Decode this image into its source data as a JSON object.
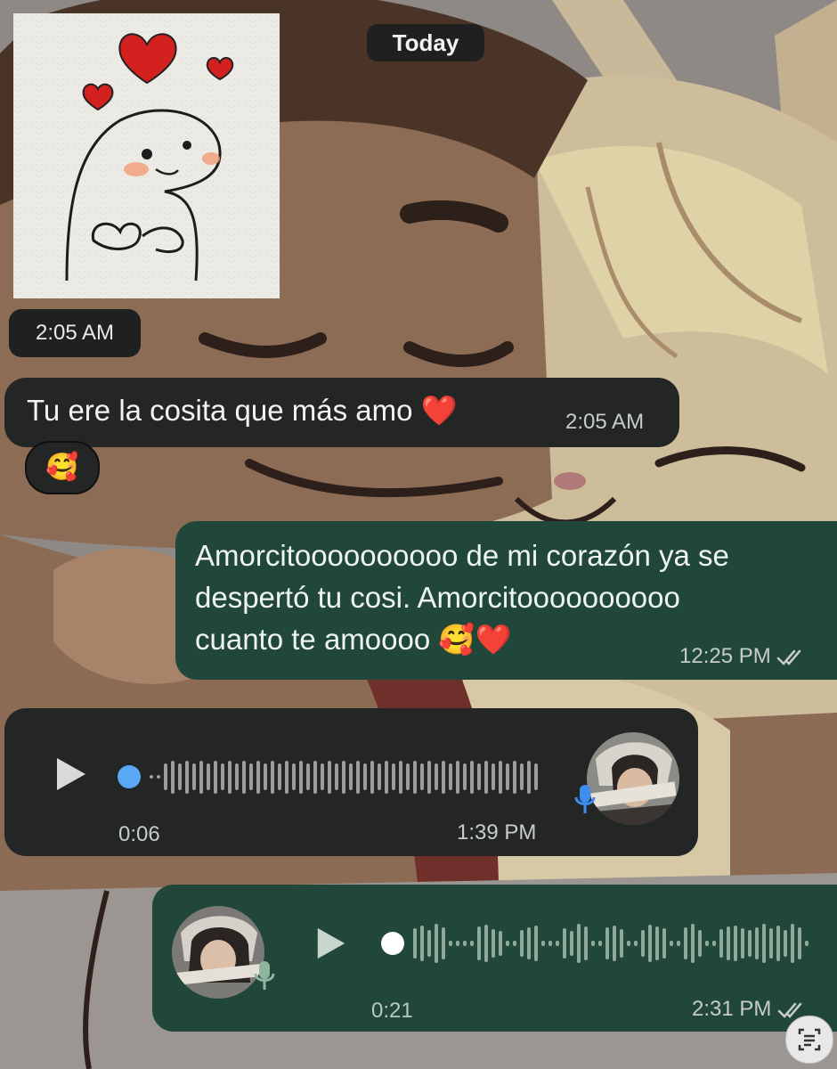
{
  "colors": {
    "incoming_bubble": "#242626",
    "outgoing_bubble": "#21463a",
    "read_ticks": "#c7cccb",
    "voice_dot_blue": "#5aa8f5",
    "mic_blue": "#3c8ef0"
  },
  "date_divider": "Today",
  "messages": [
    {
      "type": "image",
      "direction": "incoming",
      "time": "2:05 AM",
      "image_desc": "sticker-heart-ghost"
    },
    {
      "type": "text",
      "direction": "incoming",
      "text": "Tu ere la cosita que más amo ❤️",
      "time": "2:05 AM",
      "reaction": "🥰"
    },
    {
      "type": "text",
      "direction": "outgoing",
      "lines": [
        "Amorcitoooooooooo de mi corazón ya se",
        "despertó tu cosi. Amorcitoooooooooo",
        "cuanto te amoooo 🥰❤️"
      ],
      "time": "12:25 PM",
      "status": "read"
    },
    {
      "type": "voice",
      "direction": "incoming",
      "duration": "0:06",
      "time": "1:39 PM",
      "progress": 0
    },
    {
      "type": "voice",
      "direction": "outgoing",
      "duration": "0:21",
      "time": "2:31 PM",
      "progress": 0,
      "status": "read"
    }
  ],
  "icons": {
    "play": "play-icon",
    "mic": "microphone-icon",
    "ticks": "double-check-icon",
    "scan": "text-scan-icon"
  }
}
